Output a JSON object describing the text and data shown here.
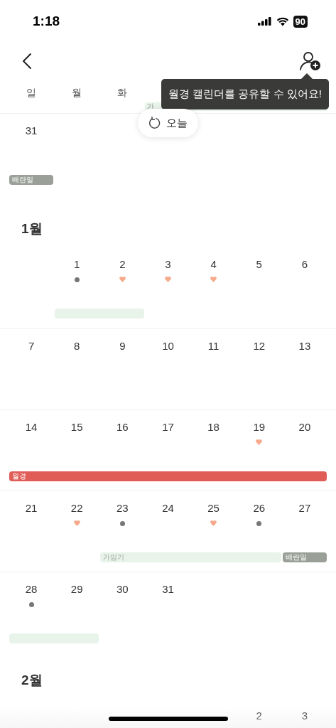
{
  "status_bar": {
    "time": "1:18",
    "battery": "90"
  },
  "header": {
    "tooltip": "월경 캘린더를 공유할 수 있어요!"
  },
  "weekdays": [
    "일",
    "월",
    "화"
  ],
  "header_band": {
    "kind": "fertile",
    "label": "가"
  },
  "today_button": {
    "label": "오늘"
  },
  "sections": [
    {
      "weeks": [
        {
          "days": [
            {
              "kind": "date",
              "day": "31",
              "bar": {
                "kind": "ovulation",
                "label": "배란일"
              }
            },
            {
              "kind": "empty"
            },
            {
              "kind": "empty"
            },
            {
              "kind": "empty"
            },
            {
              "kind": "empty"
            },
            {
              "kind": "empty"
            },
            {
              "kind": "empty"
            }
          ]
        }
      ]
    },
    {
      "title": "1월",
      "weeks": [
        {
          "days": [
            {
              "kind": "empty"
            },
            {
              "kind": "date",
              "day": "1",
              "marker": {
                "kind": "dot"
              },
              "bar": {
                "kind": "fertile"
              }
            },
            {
              "kind": "date",
              "day": "2",
              "marker": {
                "kind": "heart"
              },
              "bar": {
                "kind": "fertile"
              }
            },
            {
              "kind": "date",
              "day": "3",
              "marker": {
                "kind": "heart"
              }
            },
            {
              "kind": "date",
              "day": "4",
              "marker": {
                "kind": "heart"
              }
            },
            {
              "kind": "date",
              "day": "5"
            },
            {
              "kind": "date",
              "day": "6"
            }
          ]
        },
        {
          "days": [
            {
              "kind": "date",
              "day": "7"
            },
            {
              "kind": "date",
              "day": "8"
            },
            {
              "kind": "date",
              "day": "9"
            },
            {
              "kind": "date",
              "day": "10"
            },
            {
              "kind": "date",
              "day": "11"
            },
            {
              "kind": "date",
              "day": "12"
            },
            {
              "kind": "date",
              "day": "13"
            }
          ]
        },
        {
          "days": [
            {
              "kind": "date",
              "day": "14",
              "bar": {
                "kind": "period",
                "label": "월경"
              }
            },
            {
              "kind": "date",
              "day": "15",
              "bar": {
                "kind": "period"
              }
            },
            {
              "kind": "date",
              "day": "16",
              "bar": {
                "kind": "period"
              }
            },
            {
              "kind": "date",
              "day": "17",
              "bar": {
                "kind": "period"
              }
            },
            {
              "kind": "date",
              "day": "18",
              "bar": {
                "kind": "period"
              }
            },
            {
              "kind": "date",
              "day": "19",
              "marker": {
                "kind": "heart"
              },
              "bar": {
                "kind": "period"
              }
            },
            {
              "kind": "date",
              "day": "20",
              "bar": {
                "kind": "period"
              }
            }
          ]
        },
        {
          "days": [
            {
              "kind": "date",
              "day": "21"
            },
            {
              "kind": "date",
              "day": "22",
              "marker": {
                "kind": "heart"
              }
            },
            {
              "kind": "date",
              "day": "23",
              "marker": {
                "kind": "dot"
              },
              "bar": {
                "kind": "fertile",
                "label": "가임기"
              }
            },
            {
              "kind": "date",
              "day": "24",
              "bar": {
                "kind": "fertile"
              }
            },
            {
              "kind": "date",
              "day": "25",
              "marker": {
                "kind": "heart"
              },
              "bar": {
                "kind": "fertile"
              }
            },
            {
              "kind": "date",
              "day": "26",
              "marker": {
                "kind": "dot"
              },
              "bar": {
                "kind": "fertile"
              }
            },
            {
              "kind": "date",
              "day": "27",
              "bar": {
                "kind": "ovulation",
                "label": "배란일"
              }
            }
          ]
        },
        {
          "days": [
            {
              "kind": "date",
              "day": "28",
              "marker": {
                "kind": "dot"
              },
              "bar": {
                "kind": "fertile"
              }
            },
            {
              "kind": "date",
              "day": "29",
              "bar": {
                "kind": "fertile"
              }
            },
            {
              "kind": "date",
              "day": "30"
            },
            {
              "kind": "date",
              "day": "31"
            },
            {
              "kind": "empty"
            },
            {
              "kind": "empty"
            },
            {
              "kind": "empty"
            }
          ]
        }
      ]
    },
    {
      "title": "2월",
      "weeks": [
        {
          "days": [
            {
              "kind": "empty"
            },
            {
              "kind": "empty"
            },
            {
              "kind": "empty"
            },
            {
              "kind": "empty"
            },
            {
              "kind": "empty"
            },
            {
              "kind": "date",
              "day": "2"
            },
            {
              "kind": "date",
              "day": "3"
            }
          ]
        }
      ]
    }
  ]
}
